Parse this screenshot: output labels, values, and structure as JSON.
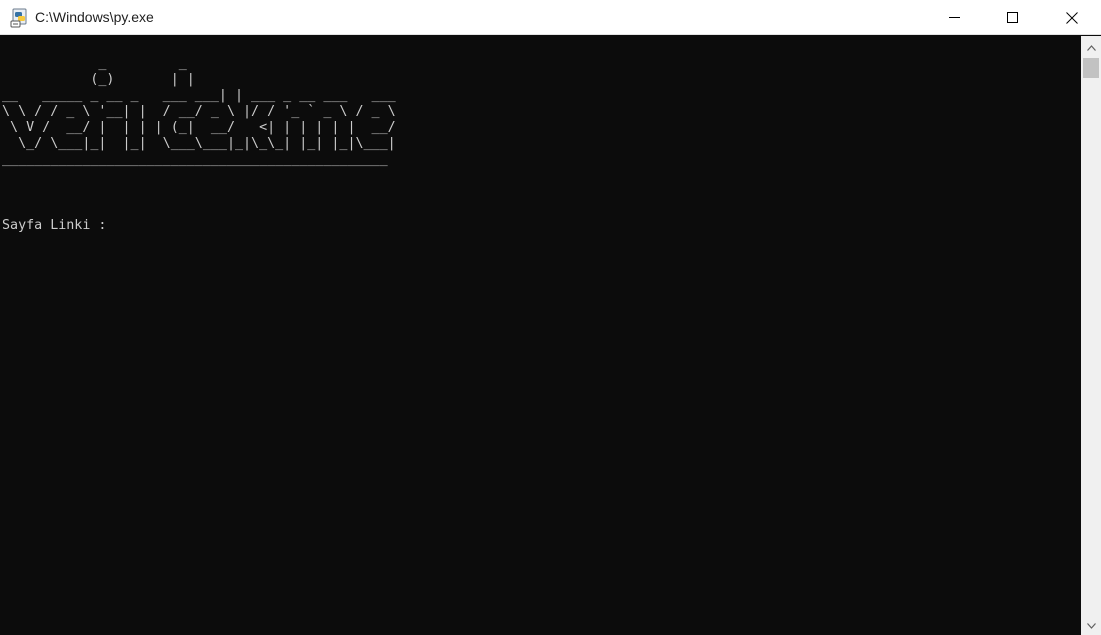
{
  "window": {
    "title": "C:\\Windows\\py.exe",
    "icon": "python-launcher-icon"
  },
  "controls": {
    "minimize_icon": "minimize-icon",
    "maximize_icon": "maximize-icon",
    "close_icon": "close-icon"
  },
  "console": {
    "banner": "            _         _\n           (_)       | |\n__   _____ _ __ _   ___ ___| | ___ _ __ ___   ___\n\\ \\ / / _ \\ '__| |  / __/ _ \\ |/ / '_ ` _ \\ / _ \\\n \\ V /  __/ |  | | | (_|  __/   <| | | | | |  __/\n  \\_/ \\___|_|  |_|  \\___\\___|_|\\_\\_| |_| |_|\\___|\n________________________________________________",
    "prompt": "Sayfa Linki : "
  },
  "colors": {
    "background": "#0c0c0c",
    "foreground": "#cccccc",
    "titlebar": "#ffffff"
  }
}
